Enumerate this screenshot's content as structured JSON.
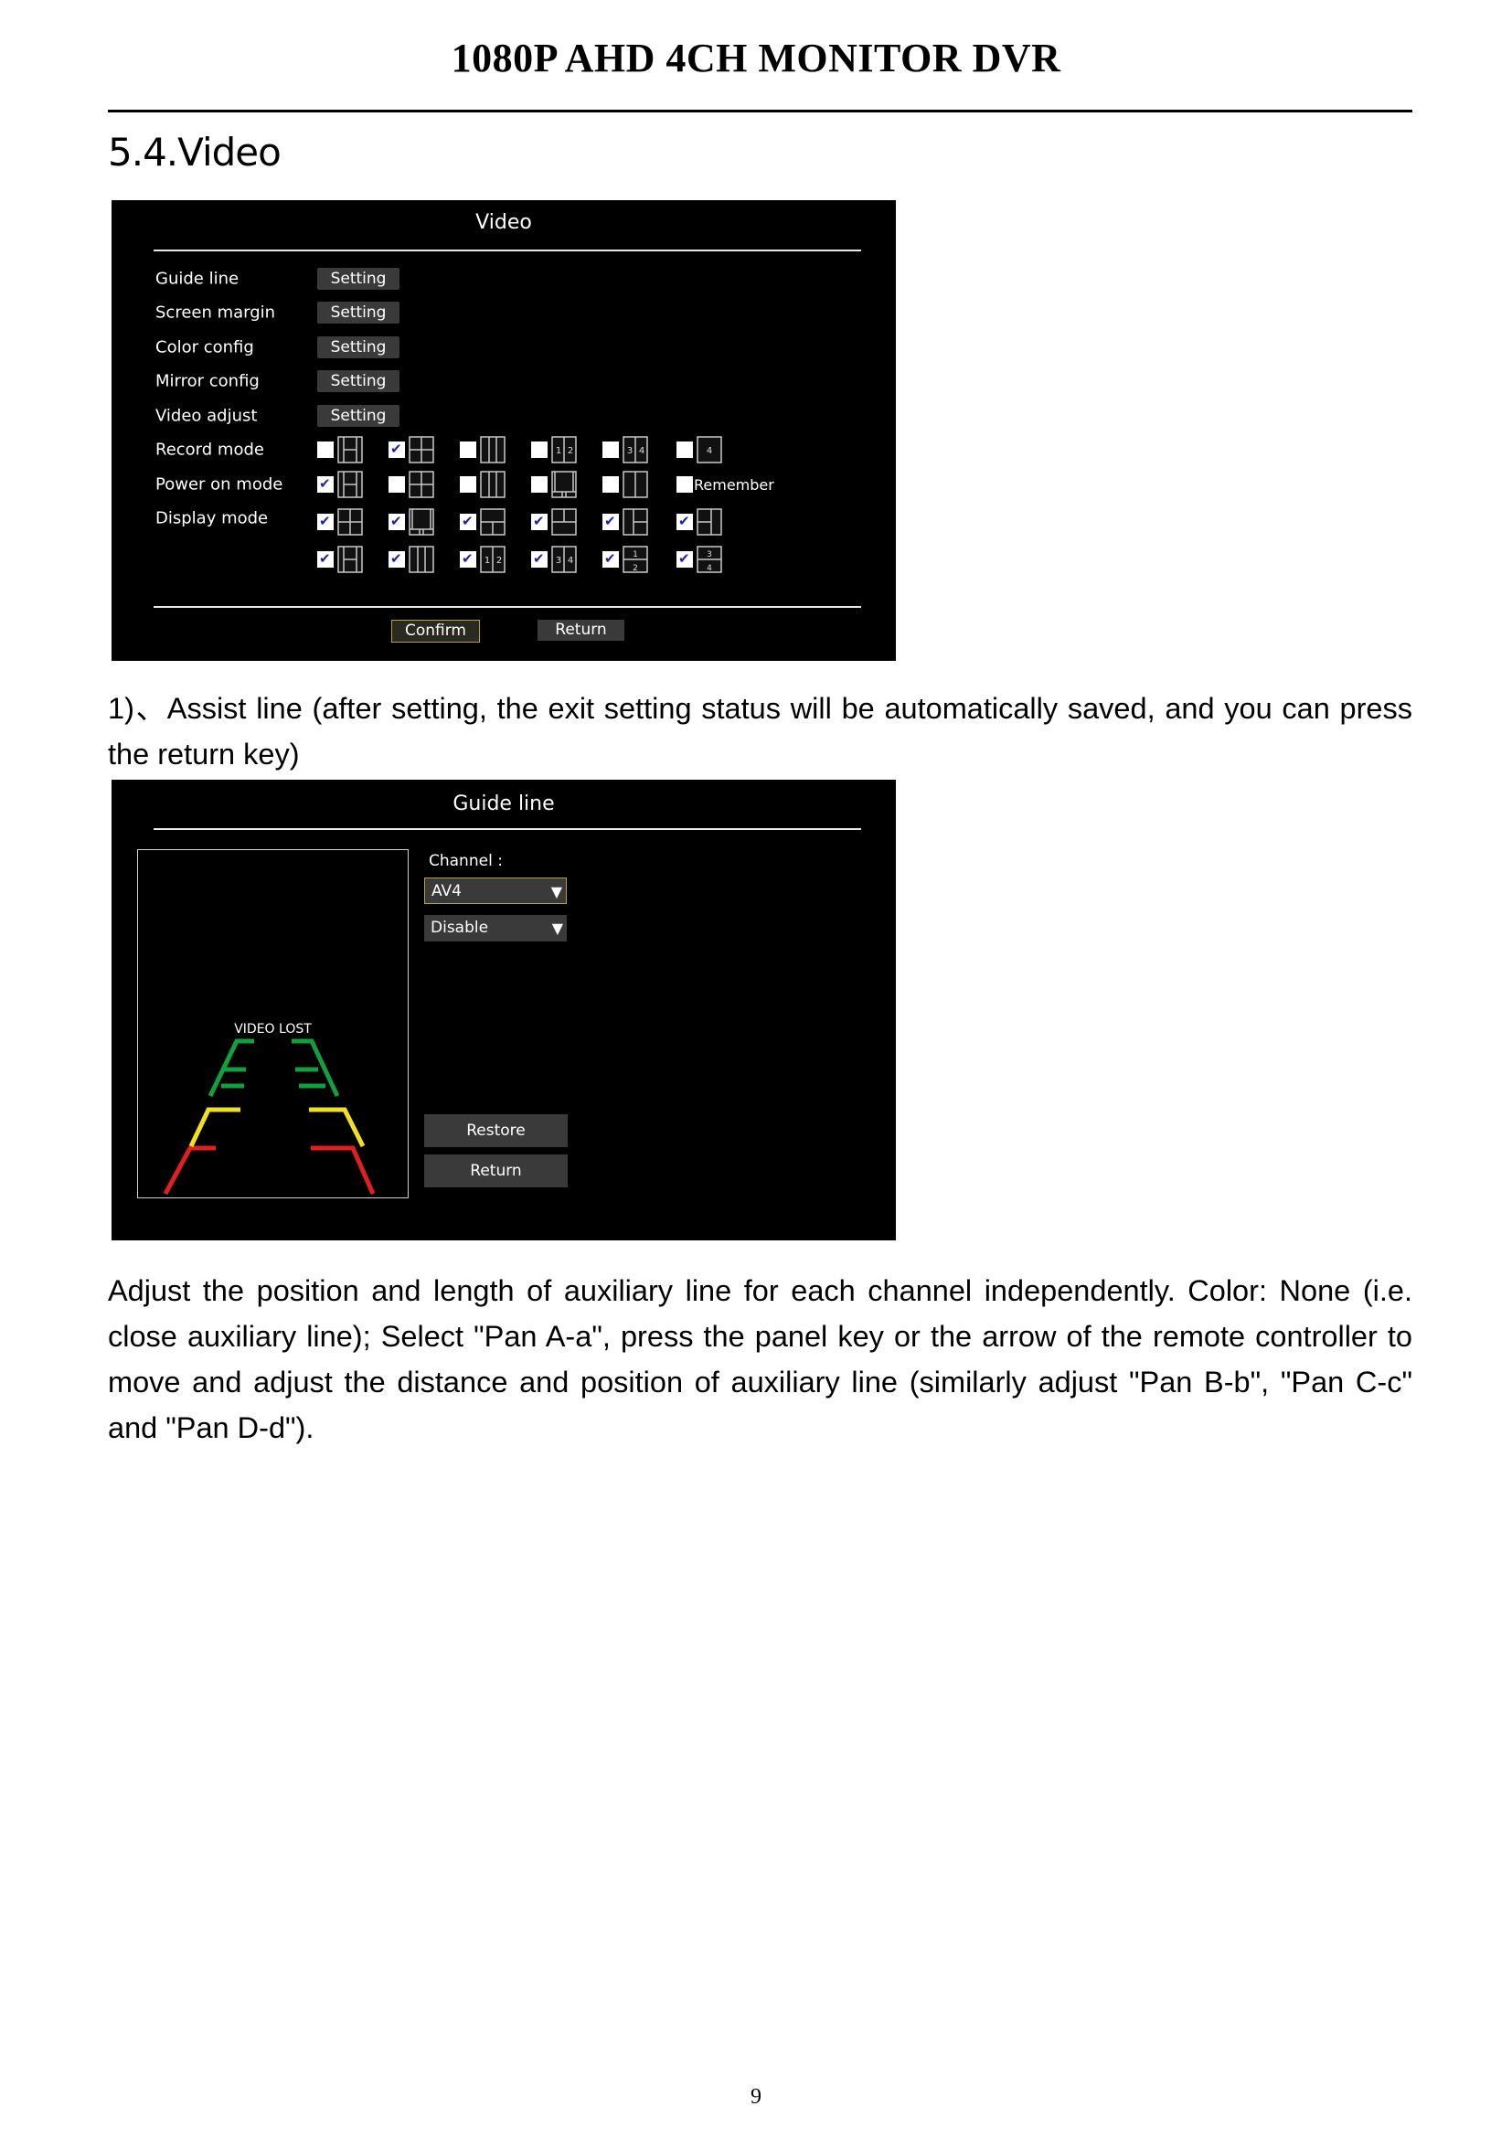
{
  "header": {
    "title": "1080P AHD 4CH MONITOR DVR"
  },
  "section_title": "5.4.Video",
  "video_menu": {
    "title": "Video",
    "settings_rows": [
      {
        "label": "Guide line",
        "button": "Setting"
      },
      {
        "label": "Screen margin",
        "button": "Setting"
      },
      {
        "label": "Color config",
        "button": "Setting"
      },
      {
        "label": "Mirror config",
        "button": "Setting"
      },
      {
        "label": "Video adjust",
        "button": "Setting"
      }
    ],
    "record_mode": {
      "label": "Record mode",
      "options": [
        {
          "layout": "1-big-2-small",
          "checked": false
        },
        {
          "layout": "quad",
          "checked": true
        },
        {
          "layout": "triple-vertical",
          "checked": false
        },
        {
          "layout": "channels-1-2",
          "text": "1 2",
          "checked": false
        },
        {
          "layout": "channels-3-4",
          "text": "3 4",
          "checked": false
        },
        {
          "layout": "channel-4",
          "text": "4",
          "checked": false
        }
      ]
    },
    "power_on_mode": {
      "label": "Power on mode",
      "options": [
        {
          "layout": "1-big-2-small",
          "checked": true
        },
        {
          "layout": "quad",
          "checked": false
        },
        {
          "layout": "triple-vertical",
          "checked": false
        },
        {
          "layout": "big-top-2-small-bottom",
          "checked": false
        },
        {
          "layout": "split-vertical",
          "checked": false
        }
      ],
      "remember": {
        "label": "Remember",
        "checked": false
      }
    },
    "display_mode": {
      "label": "Display mode",
      "rows": [
        [
          {
            "layout": "quad",
            "checked": true
          },
          {
            "layout": "big-top-3-small-bottom",
            "checked": true
          },
          {
            "layout": "top-1-bottom-2",
            "checked": true
          },
          {
            "layout": "top-2-bottom-1",
            "checked": true
          },
          {
            "layout": "left-1-right-2",
            "checked": true
          },
          {
            "layout": "left-2-right-1",
            "checked": true
          }
        ],
        [
          {
            "layout": "1-big-2-small",
            "checked": true
          },
          {
            "layout": "triple-vertical",
            "checked": true
          },
          {
            "layout": "channels-1-2",
            "text": "1 2",
            "checked": true
          },
          {
            "layout": "channels-3-4",
            "text": "3 4",
            "checked": true
          },
          {
            "layout": "stacked-1-2",
            "text": "1/2",
            "checked": true
          },
          {
            "layout": "stacked-3-4",
            "text": "3/4",
            "checked": true
          }
        ]
      ]
    },
    "confirm_label": "Confirm",
    "return_label": "Return"
  },
  "para1": "1)、Assist line (after setting, the exit setting status will be automatically saved, and you can press the return key)",
  "guide_line": {
    "title": "Guide line",
    "video_status": "VIDEO LOST",
    "channel_label": "Channel :",
    "channel_value": "AV4",
    "mode_value": "Disable",
    "restore_label": "Restore",
    "return_label": "Return",
    "colors": {
      "near": "#e02020",
      "mid": "#f0e020",
      "far": "#10a040"
    }
  },
  "para2": "Adjust the position and length of auxiliary line for each channel independently. Color: None (i.e. close auxiliary line);   Select \"Pan A-a\", press the panel key or the arrow of the remote controller to move and adjust the distance and position of auxiliary line (similarly adjust \"Pan B-b\", \"Pan C-c\" and \"Pan D-d\").",
  "page_number": "9"
}
